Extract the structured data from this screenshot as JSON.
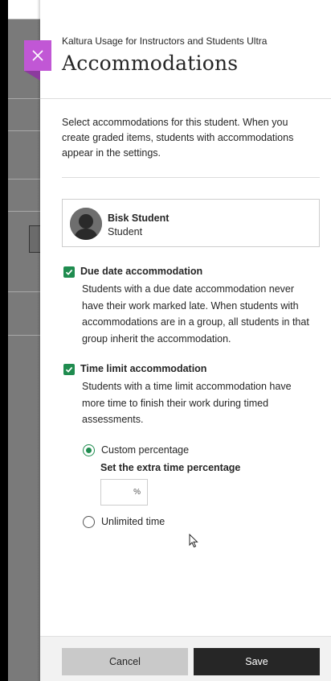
{
  "panel": {
    "course_name": "Kaltura Usage for Instructors and Students Ultra",
    "title": "Accommodations",
    "intro": "Select accommodations for this student. When you create graded items, students with accommodations appear in the settings."
  },
  "student": {
    "name": "Bisk Student",
    "role": "Student"
  },
  "due_date": {
    "label": "Due date accommodation",
    "checked": true,
    "description": "Students with a due date accommodation never have their work marked late. When students with accommodations are in a group, all students in that group inherit the accommodation."
  },
  "time_limit": {
    "label": "Time limit accommodation",
    "checked": true,
    "description": "Students with a time limit accommodation have more time to finish their work during timed assessments.",
    "options": {
      "custom_label": "Custom percentage",
      "custom_selected": true,
      "unlimited_label": "Unlimited time",
      "unlimited_selected": false
    },
    "percentage_label": "Set the extra time percentage",
    "percentage_value": "",
    "percentage_unit": "%"
  },
  "footer": {
    "cancel_label": "Cancel",
    "save_label": "Save"
  },
  "colors": {
    "accent_close": "#c157d5",
    "check_green": "#1f8c4f",
    "save_bg": "#262626"
  },
  "icons": {
    "close": "close-icon",
    "checkbox": "checkmark-icon",
    "avatar": "user-silhouette-icon",
    "cursor": "mouse-pointer-icon"
  }
}
